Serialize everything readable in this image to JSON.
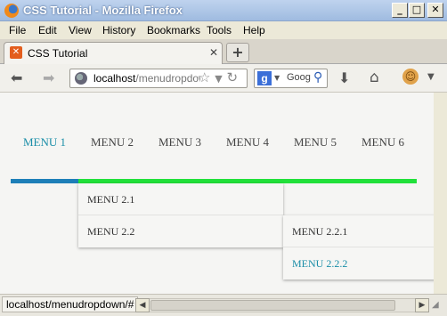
{
  "window": {
    "title": "CSS Tutorial - Mozilla Firefox",
    "buttons": {
      "minimize": "_",
      "maximize": "□",
      "close": "✕"
    }
  },
  "menubar": [
    "File",
    "Edit",
    "View",
    "History",
    "Bookmarks",
    "Tools",
    "Help"
  ],
  "tab": {
    "title": "CSS Tutorial",
    "new_tab": "+"
  },
  "toolbar": {
    "url_host": "localhost",
    "url_path": "/menudropdown",
    "search_engine_letter": "g",
    "search_placeholder": "Goog"
  },
  "page": {
    "menus": [
      "MENU 1",
      "MENU 2",
      "MENU 3",
      "MENU 4",
      "MENU 5",
      "MENU 6"
    ],
    "active_menu": "MENU 1",
    "dropdown_level1": [
      "MENU 2.1",
      "MENU 2.2"
    ],
    "dropdown_level2": [
      "MENU 2.2.1",
      "MENU 2.2.2"
    ],
    "colors": {
      "active_text": "#1b8ea8",
      "blue_bar": "#1e7fb8",
      "green_bar": "#21e03a"
    }
  },
  "status": {
    "link": "localhost/menudropdown/#"
  }
}
